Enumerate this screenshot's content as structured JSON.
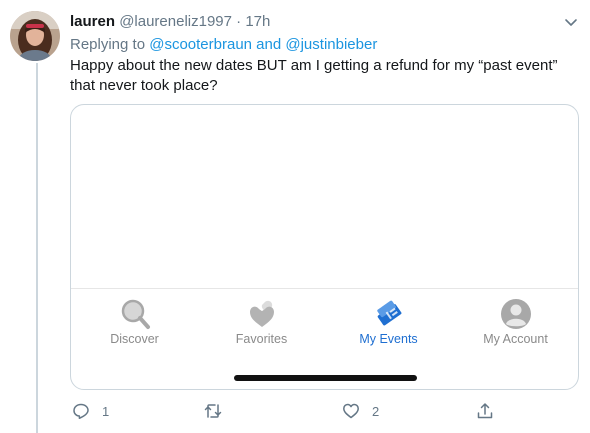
{
  "tweet": {
    "display_name": "lauren",
    "handle": "@laureneliz1997",
    "separator": "·",
    "time": "17h",
    "replying_prefix": "Replying to ",
    "replying_to": [
      "@scooterbraun",
      "@justinbieber"
    ],
    "replying_joiner": " and ",
    "text": "Happy about the new dates BUT am I getting a refund for my “past event” that never took place?"
  },
  "embedded_app": {
    "tabs": [
      {
        "label": "Discover",
        "icon": "search-icon",
        "active": false
      },
      {
        "label": "Favorites",
        "icon": "hearts-icon",
        "active": false
      },
      {
        "label": "My Events",
        "icon": "tickets-icon",
        "active": true
      },
      {
        "label": "My Account",
        "icon": "account-icon",
        "active": false
      }
    ],
    "active_color": "#1f6fd1",
    "inactive_color": "#8a8a8a"
  },
  "actions": {
    "reply_count": "1",
    "retweet_count": "",
    "like_count": "2"
  },
  "colors": {
    "mention": "#1b95e0",
    "muted": "#657786"
  }
}
